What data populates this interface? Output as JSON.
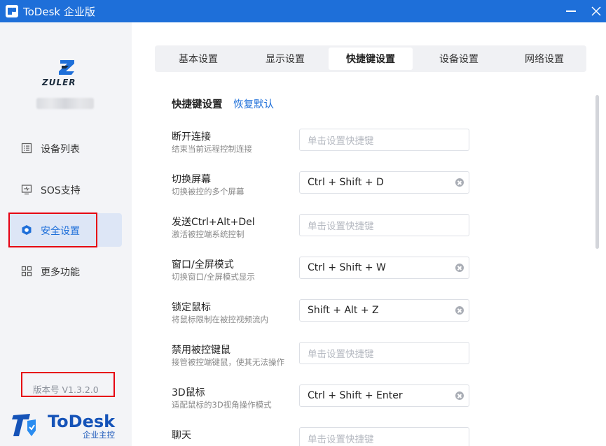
{
  "window": {
    "title": "ToDesk 企业版"
  },
  "sidebar": {
    "brand_name": "ZULER",
    "items": [
      {
        "label": "设备列表",
        "icon": "list-icon"
      },
      {
        "label": "SOS支持",
        "icon": "monitor-icon"
      },
      {
        "label": "安全设置",
        "icon": "shield-icon",
        "active": true
      },
      {
        "label": "更多功能",
        "icon": "grid-icon"
      }
    ],
    "version": "版本号 V1.3.2.0",
    "footer_brand": "ToDesk",
    "footer_sub": "企业主控"
  },
  "tabs": [
    {
      "label": "基本设置"
    },
    {
      "label": "显示设置"
    },
    {
      "label": "快捷键设置",
      "active": true
    },
    {
      "label": "设备设置"
    },
    {
      "label": "网络设置"
    }
  ],
  "section": {
    "title": "快捷键设置",
    "restore_label": "恢复默认"
  },
  "placeholder": "单击设置快捷键",
  "shortcuts": [
    {
      "name": "断开连接",
      "desc": "结束当前远程控制连接",
      "value": ""
    },
    {
      "name": "切换屏幕",
      "desc": "切换被控的多个屏幕",
      "value": "Ctrl + Shift + D"
    },
    {
      "name": "发送Ctrl+Alt+Del",
      "desc": "激活被控端系统控制",
      "value": ""
    },
    {
      "name": "窗口/全屏模式",
      "desc": "切换窗口/全屏模式显示",
      "value": "Ctrl + Shift + W"
    },
    {
      "name": "锁定鼠标",
      "desc": "将鼠标限制在被控视频流内",
      "value": "Shift + Alt + Z"
    },
    {
      "name": "禁用被控键鼠",
      "desc": "接管被控端键鼠，使其无法操作",
      "value": ""
    },
    {
      "name": "3D鼠标",
      "desc": "适配鼠标的3D视角操作模式",
      "value": "Ctrl + Shift + Enter"
    },
    {
      "name": "聊天",
      "desc": "",
      "value": ""
    }
  ],
  "colors": {
    "accent": "#1e6fd9",
    "highlight_box": "#e60012"
  }
}
